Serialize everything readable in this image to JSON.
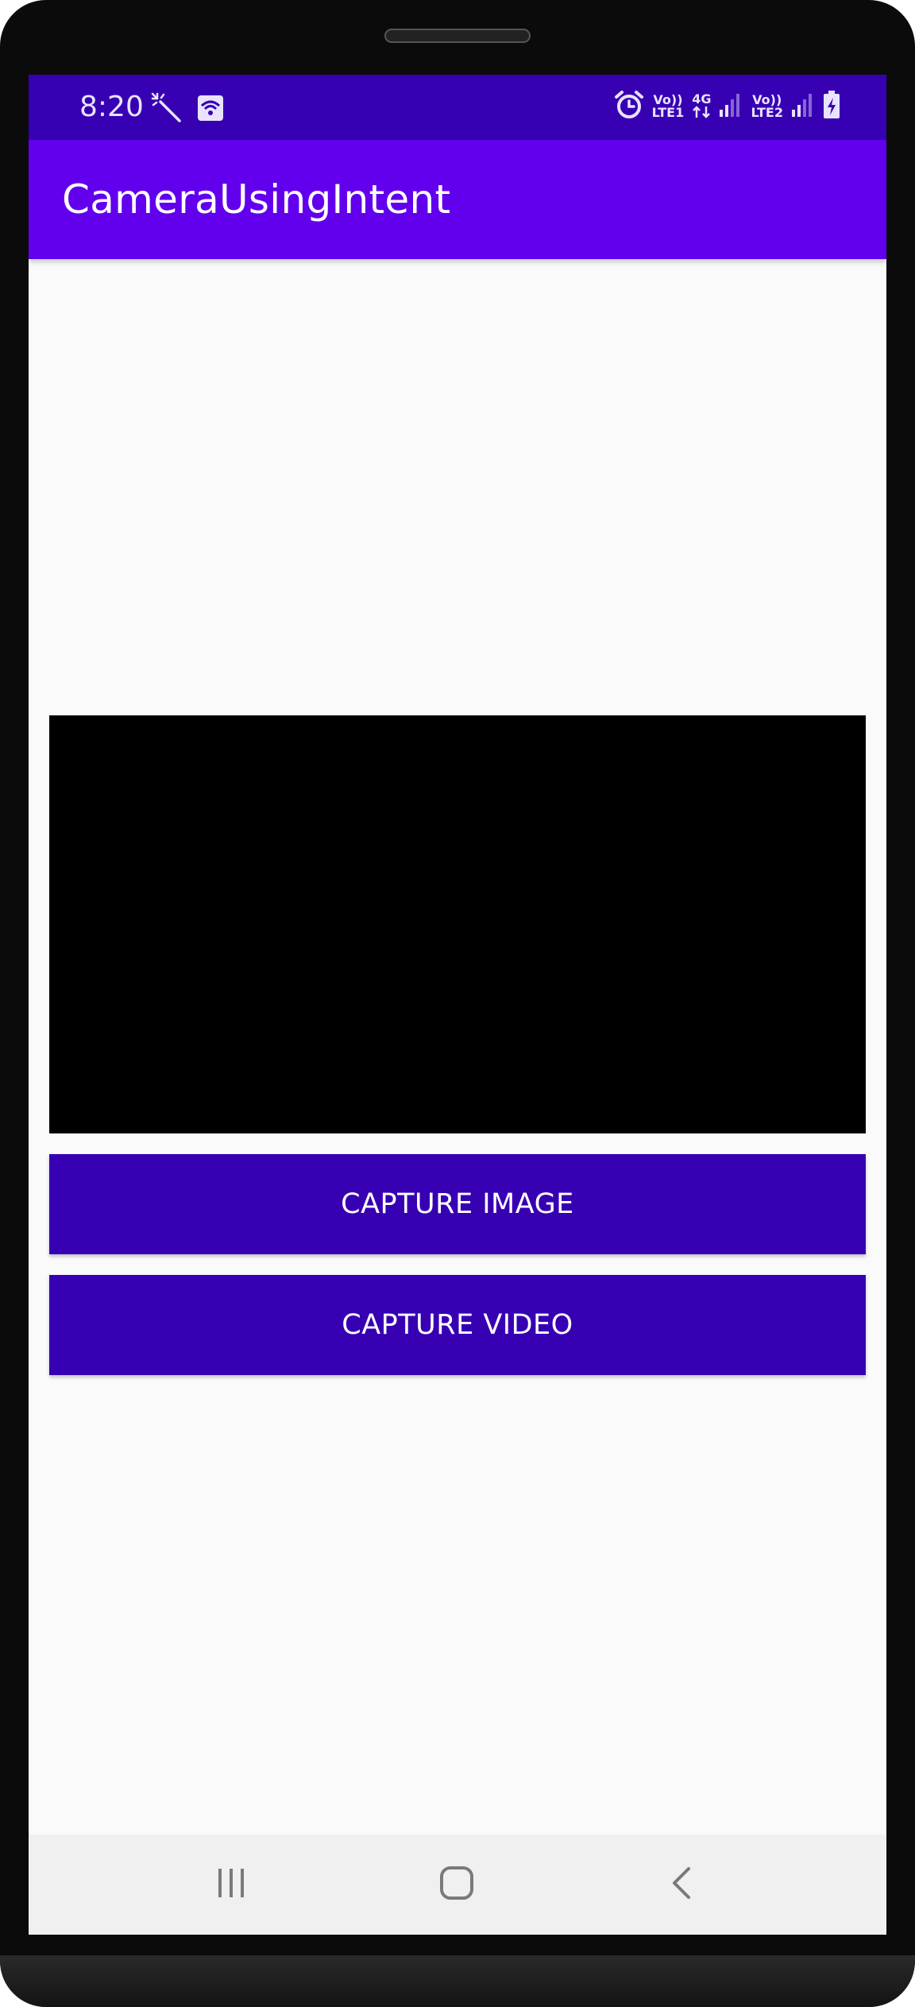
{
  "status_bar": {
    "time": "8:20",
    "left_icons": [
      "magic-wand-icon",
      "wifi-calling-icon"
    ],
    "right_icons": [
      "alarm-icon",
      "volte-lte1-icon",
      "4g-data-icon",
      "signal-sim1-icon",
      "volte-lte2-icon",
      "signal-sim2-icon",
      "battery-charging-icon"
    ],
    "volte1_top": "Vo))",
    "volte1_bottom": "LTE1",
    "data_top": "4G",
    "volte2_top": "Vo))",
    "volte2_bottom": "LTE2"
  },
  "app_bar": {
    "title": "CameraUsingIntent"
  },
  "buttons": {
    "capture_image": "CAPTURE IMAGE",
    "capture_video": "CAPTURE VIDEO"
  },
  "nav_bar": {
    "icons": [
      "recents-icon",
      "home-icon",
      "back-icon"
    ]
  },
  "colors": {
    "status_bar": "#3700b3",
    "app_bar": "#6200ee",
    "button": "#3700b3",
    "screen_background": "#fafafa",
    "video_view": "#000000",
    "nav_bar": "#f0f0f0"
  }
}
